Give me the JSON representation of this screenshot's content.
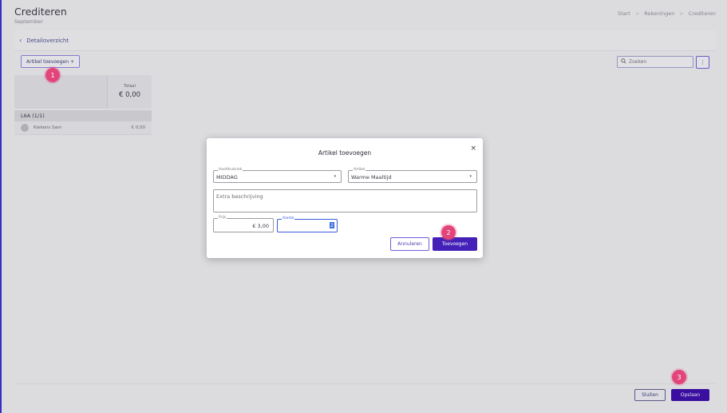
{
  "header": {
    "title": "Crediteren",
    "subtitle": "September",
    "breadcrumb": [
      {
        "label": "Start"
      },
      {
        "label": "Rekeningen"
      },
      {
        "label": "Crediteren"
      }
    ],
    "breadcrumb_separator": ">"
  },
  "detail_bar": {
    "back_label": "Detailoverzicht"
  },
  "toolbar": {
    "add_article_label": "Artikel toevoegen +",
    "search_placeholder": "Zoeken",
    "more_label": "⋮"
  },
  "grid": {
    "total_label": "Totaal",
    "total_value": "€ 0,00",
    "group_label": "L6A (1/1)",
    "rows": [
      {
        "name": "Kiekens Sam",
        "amount": "€ 0,00"
      }
    ]
  },
  "footer": {
    "close_label": "Sluiten",
    "save_label": "Opslaan"
  },
  "modal": {
    "title": "Artikel toevoegen",
    "close_symbol": "×",
    "hoofdrubriek": {
      "label": "Hoofdrubriek",
      "value": "MIDDAG"
    },
    "artikel": {
      "label": "Artikel",
      "value": "Warme Maaltijd"
    },
    "extra": {
      "placeholder": "Extra beschrijving"
    },
    "prijs": {
      "label": "Prijs",
      "value": "€ 3,00"
    },
    "aantal": {
      "label": "Aantal",
      "value": "2"
    },
    "cancel_label": "Annuleren",
    "submit_label": "Toevoegen"
  },
  "markers": [
    "1",
    "2",
    "3"
  ],
  "colors": {
    "primary": "#4321b8",
    "marker": "#e2457a",
    "accent_border": "#3b2fd0"
  }
}
